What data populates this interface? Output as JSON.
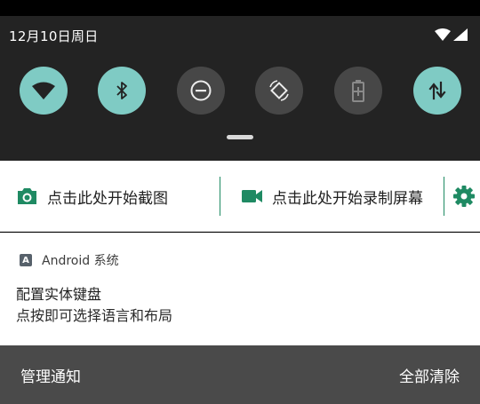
{
  "status": {
    "date": "12月10日周日",
    "icons": [
      "wifi-signal-icon",
      "cell-signal-icon"
    ]
  },
  "quick_settings": {
    "tiles": [
      {
        "name": "wifi",
        "icon": "wifi-icon",
        "state": "on"
      },
      {
        "name": "bluetooth",
        "icon": "bluetooth-icon",
        "state": "on"
      },
      {
        "name": "do-not-disturb",
        "icon": "do-not-disturb-icon",
        "state": "off"
      },
      {
        "name": "auto-rotate",
        "icon": "auto-rotate-icon",
        "state": "off"
      },
      {
        "name": "battery-saver",
        "icon": "battery-saver-icon",
        "state": "off"
      },
      {
        "name": "mobile-data",
        "icon": "mobile-data-icon",
        "state": "on"
      }
    ],
    "colors": {
      "on": "#7fcbc4",
      "off": "#474747",
      "panel": "#232323"
    }
  },
  "actions": {
    "screenshot_label": "点击此处开始截图",
    "record_label": "点击此处开始录制屏幕",
    "accent": "#1f8a63"
  },
  "notification": {
    "app_icon_letter": "A",
    "app_name": "Android 系统",
    "title": "配置实体键盘",
    "body": "点按即可选择语言和布局"
  },
  "footer": {
    "manage_label": "管理通知",
    "clear_all_label": "全部清除"
  }
}
